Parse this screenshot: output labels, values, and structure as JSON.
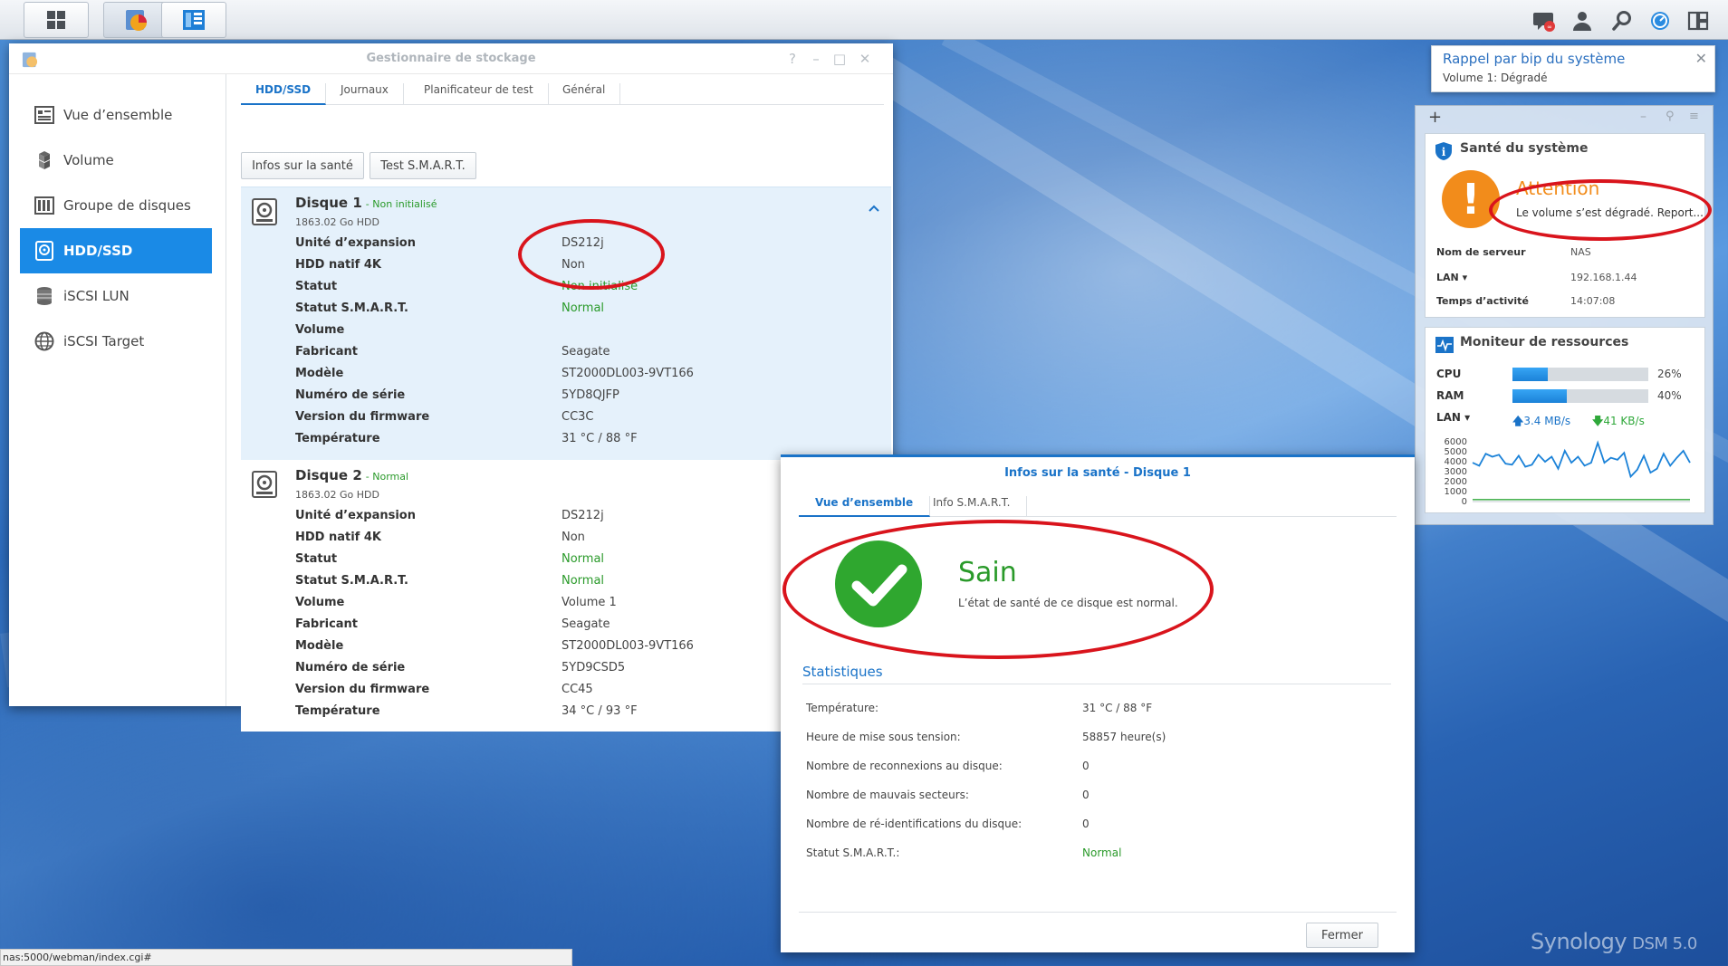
{
  "desktop": {
    "status_url": "nas:5000/webman/index.cgi#",
    "brand": "Synology",
    "brand_version": "DSM 5.0"
  },
  "storage_manager": {
    "title": "Gestionnaire de stockage",
    "sidebar": [
      {
        "label": "Vue d’ensemble",
        "icon": "overview-icon"
      },
      {
        "label": "Volume",
        "icon": "volume-icon"
      },
      {
        "label": "Groupe de disques",
        "icon": "disk-group-icon"
      },
      {
        "label": "HDD/SSD",
        "icon": "hdd-icon",
        "active": true
      },
      {
        "label": "iSCSI LUN",
        "icon": "iscsi-lun-icon"
      },
      {
        "label": "iSCSI Target",
        "icon": "iscsi-target-icon"
      }
    ],
    "tabs": [
      "HDD/SSD",
      "Journaux",
      "Planificateur de test",
      "Général"
    ],
    "buttons": {
      "health_info": "Infos sur la santé",
      "smart_test": "Test S.M.A.R.T."
    },
    "disks": [
      {
        "name": "Disque 1",
        "status_suffix": "- Non initialisé",
        "capacity": "1863.02 Go HDD",
        "props": [
          {
            "k": "Unité d’expansion",
            "v": "DS212j"
          },
          {
            "k": "HDD natif 4K",
            "v": "Non"
          },
          {
            "k": "Statut",
            "v": "Non initialisé",
            "green": true
          },
          {
            "k": "Statut S.M.A.R.T.",
            "v": "Normal",
            "green": true
          },
          {
            "k": "Volume",
            "v": ""
          },
          {
            "k": "Fabricant",
            "v": "Seagate"
          },
          {
            "k": "Modèle",
            "v": "ST2000DL003-9VT166"
          },
          {
            "k": "Numéro de série",
            "v": "5YD8QJFP"
          },
          {
            "k": "Version du firmware",
            "v": "CC3C"
          },
          {
            "k": "Température",
            "v": "31 °C / 88 °F"
          }
        ]
      },
      {
        "name": "Disque 2",
        "status_suffix": "- Normal",
        "capacity": "1863.02 Go HDD",
        "props": [
          {
            "k": "Unité d’expansion",
            "v": "DS212j"
          },
          {
            "k": "HDD natif 4K",
            "v": "Non"
          },
          {
            "k": "Statut",
            "v": "Normal",
            "green": true
          },
          {
            "k": "Statut S.M.A.R.T.",
            "v": "Normal",
            "green": true
          },
          {
            "k": "Volume",
            "v": "Volume 1"
          },
          {
            "k": "Fabricant",
            "v": "Seagate"
          },
          {
            "k": "Modèle",
            "v": "ST2000DL003-9VT166"
          },
          {
            "k": "Numéro de série",
            "v": "5YD9CSD5"
          },
          {
            "k": "Version du firmware",
            "v": "CC45"
          },
          {
            "k": "Température",
            "v": "34 °C / 93 °F"
          }
        ]
      }
    ]
  },
  "notification": {
    "title": "Rappel par bip du système",
    "message": "Volume 1: Dégradé"
  },
  "system_health": {
    "title": "Santé du système",
    "status": "Attention",
    "message": "Le volume s’est dégradé. Report...",
    "rows": [
      {
        "k": "Nom de serveur",
        "v": "NAS"
      },
      {
        "k": "LAN",
        "v": "192.168.1.44"
      },
      {
        "k": "Temps d’activité",
        "v": "14:07:08"
      }
    ]
  },
  "resource_monitor": {
    "title": "Moniteur de ressources",
    "cpu_label": "CPU",
    "cpu_percent": 26,
    "cpu_text": "26%",
    "ram_label": "RAM",
    "ram_percent": 40,
    "ram_text": "40%",
    "lan_label": "LAN",
    "upload": "3.4 MB/s",
    "download": "41 KB/s",
    "chart_ticks": [
      "6000",
      "5000",
      "4000",
      "3000",
      "2000",
      "1000",
      "0"
    ],
    "chart_data": {
      "type": "line",
      "ylim": [
        0,
        6000
      ],
      "series": [
        {
          "values": [
            3900,
            3600,
            4800,
            4500,
            4700,
            3800,
            3700,
            4600,
            3500,
            3700,
            4700,
            4000,
            4500,
            3300,
            5100,
            3900,
            4500,
            3600,
            3900,
            5900,
            3900,
            4400,
            4200,
            4900,
            2500,
            3200,
            4600,
            2900,
            3300,
            4800,
            3600,
            4400,
            5100,
            3900
          ],
          "color": "#1b82d8"
        },
        {
          "values": [
            200,
            200,
            200,
            200,
            200,
            200,
            200,
            200,
            200,
            200,
            200,
            200,
            200,
            200,
            200,
            200,
            200,
            200,
            200,
            200,
            200,
            200,
            200,
            200,
            200,
            200,
            200,
            200,
            200,
            200,
            200,
            200,
            200,
            200
          ],
          "color": "#2fa83a"
        }
      ]
    }
  },
  "health_dialog": {
    "title": "Infos sur la santé - Disque 1",
    "tabs": [
      "Vue d’ensemble",
      "Info S.M.A.R.T."
    ],
    "status": "Sain",
    "status_desc": "L’état de santé de ce disque est normal.",
    "stats_title": "Statistiques",
    "stats": [
      {
        "k": "Température:",
        "v": "31 °C / 88 °F"
      },
      {
        "k": "Heure de mise sous tension:",
        "v": "58857 heure(s)"
      },
      {
        "k": "Nombre de reconnexions au disque:",
        "v": "0"
      },
      {
        "k": "Nombre de mauvais secteurs:",
        "v": "0"
      },
      {
        "k": "Nombre de ré-identifications du disque:",
        "v": "0"
      },
      {
        "k": "Statut S.M.A.R.T.:",
        "v": "Normal",
        "green": true
      }
    ],
    "close": "Fermer"
  },
  "colors": {
    "accent": "#1a8ae6",
    "ok": "#2a9a2a",
    "warning": "#f28c1b",
    "annotation": "#d9141c"
  }
}
